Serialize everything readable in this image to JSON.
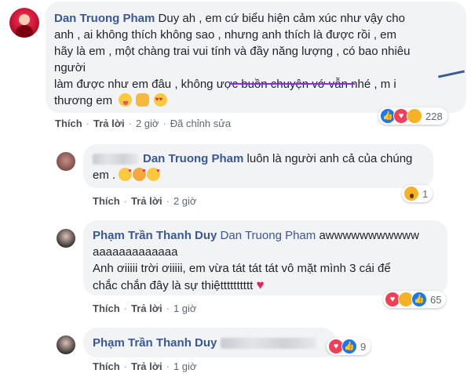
{
  "comments": [
    {
      "author": "Dan Truong Pham",
      "line1": "Duy ah , em cứ biểu hiện cảm xúc như vậy cho",
      "line2": "anh , ai không thích không sao , nhưng anh thích là được rồi , em",
      "line3": "hãy là em , một chàng trai vui tính và đầy năng lượng , có bao nhiêu",
      "line4": "người",
      "line5": "làm được như em đâu , không  ược buồn chuyện vớ vẫn nhé , m i",
      "line6": "thương em",
      "like": "Thích",
      "reply": "Trả lời",
      "time": "2 giờ",
      "edited": "Đã chỉnh sửa",
      "reaction_count": "228",
      "reactions": [
        "like",
        "love",
        "haha"
      ]
    },
    {
      "author": "Dan Truong Pham",
      "line1": "luôn là người anh cả của chúng",
      "line2": "em .",
      "like": "Thích",
      "reply": "Trả lời",
      "time": "2 giờ",
      "reaction_count": "1",
      "reactions": [
        "wow"
      ]
    },
    {
      "author": "Phạm Trần Thanh Duy",
      "tag": "Dan Truong Pham",
      "line1_tail": "awwwwwwwwwww",
      "line2": "aaaaaaaaaaaaa",
      "line3": "Anh ơiiiii trời ơiiiii, em vừa tát tát tát vô mặt mình 3 cái để",
      "line4": "chắc chắn đây là sự thiệtttttttttt",
      "like": "Thích",
      "reply": "Trả lời",
      "time": "1 giờ",
      "reaction_count": "65",
      "reactions": [
        "love",
        "haha",
        "like"
      ]
    },
    {
      "author": "Phạm Trần Thanh Duy",
      "like": "Thích",
      "reply": "Trả lời",
      "time": "1 giờ",
      "reaction_count": "9",
      "reactions": [
        "love",
        "like"
      ]
    }
  ],
  "colors": {
    "bubble": "#f2f3f5",
    "name": "#385898",
    "like_blue": "#1877f2",
    "love_red": "#f33e58",
    "haha_yellow": "#f7b125"
  }
}
